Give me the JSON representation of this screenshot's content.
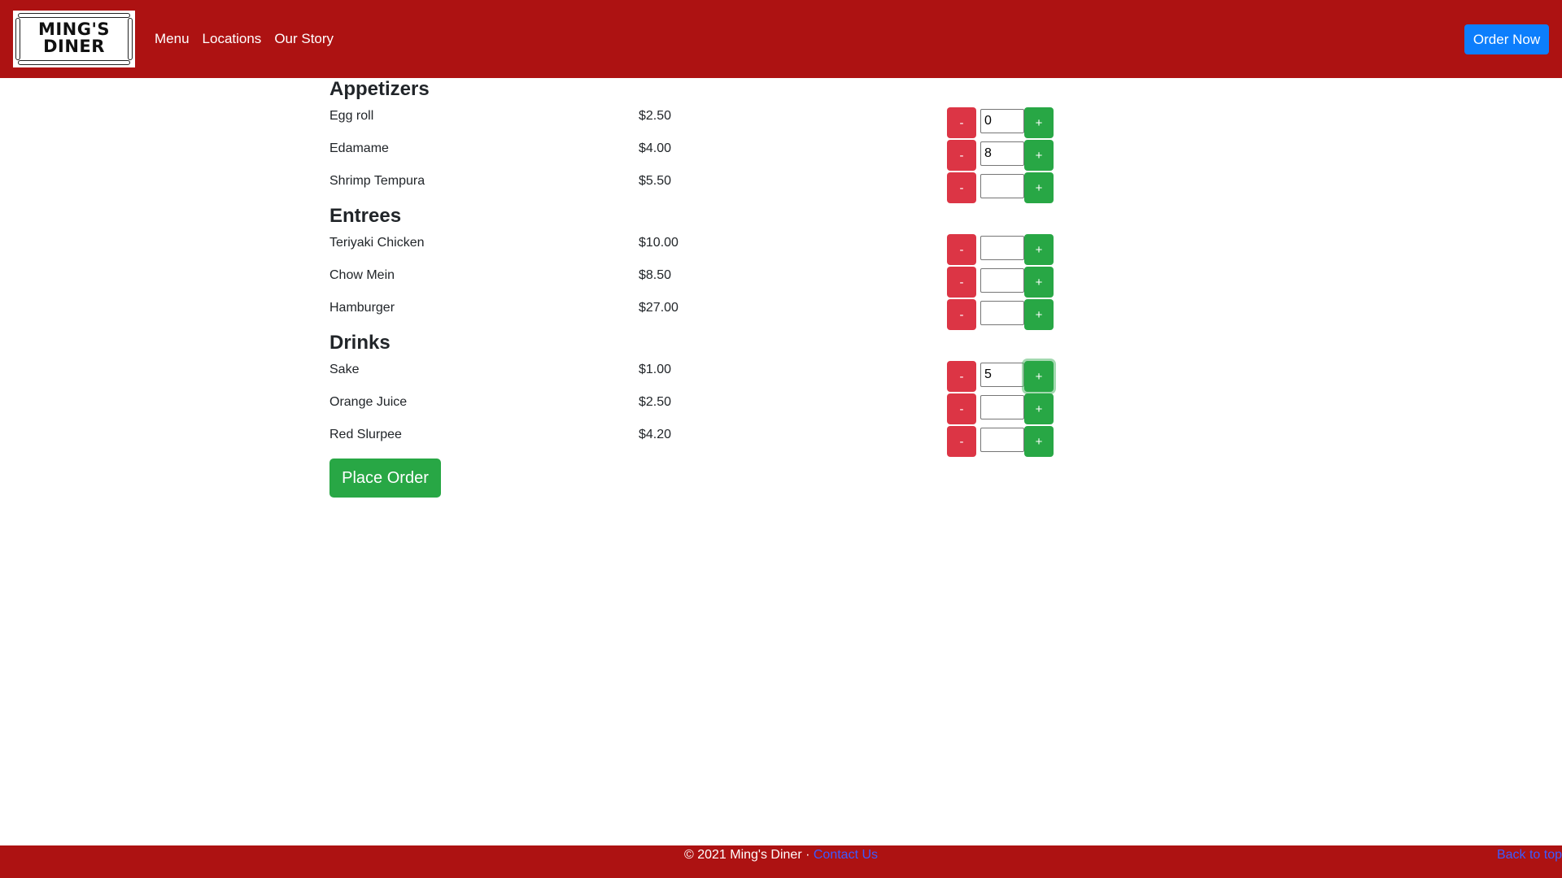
{
  "header": {
    "logo_line1": "MING'S",
    "logo_line2": "DINER",
    "nav": [
      "Menu",
      "Locations",
      "Our Story"
    ],
    "order_now": "Order Now"
  },
  "menu": {
    "sections": [
      {
        "title": "Appetizers",
        "items": [
          {
            "name": "Egg roll",
            "price": "$2.50",
            "qty": "0"
          },
          {
            "name": "Edamame",
            "price": "$4.00",
            "qty": "8"
          },
          {
            "name": "Shrimp Tempura",
            "price": "$5.50",
            "qty": ""
          }
        ]
      },
      {
        "title": "Entrees",
        "items": [
          {
            "name": "Teriyaki Chicken",
            "price": "$10.00",
            "qty": ""
          },
          {
            "name": "Chow Mein",
            "price": "$8.50",
            "qty": ""
          },
          {
            "name": "Hamburger",
            "price": "$27.00",
            "qty": ""
          }
        ]
      },
      {
        "title": "Drinks",
        "items": [
          {
            "name": "Sake",
            "price": "$1.00",
            "qty": "5"
          },
          {
            "name": "Orange Juice",
            "price": "$2.50",
            "qty": ""
          },
          {
            "name": "Red Slurpee",
            "price": "$4.20",
            "qty": ""
          }
        ]
      }
    ],
    "minus_label": "-",
    "plus_label": "+",
    "place_order": "Place Order"
  },
  "footer": {
    "copyright": "© 2021 Ming's Diner · ",
    "contact": "Contact Us",
    "back_to_top": "Back to top"
  },
  "colors": {
    "brand_red": "#ad1212",
    "primary_blue": "#0d7efc",
    "danger": "#dc3545",
    "success": "#28a745",
    "link": "#3b5bff"
  }
}
